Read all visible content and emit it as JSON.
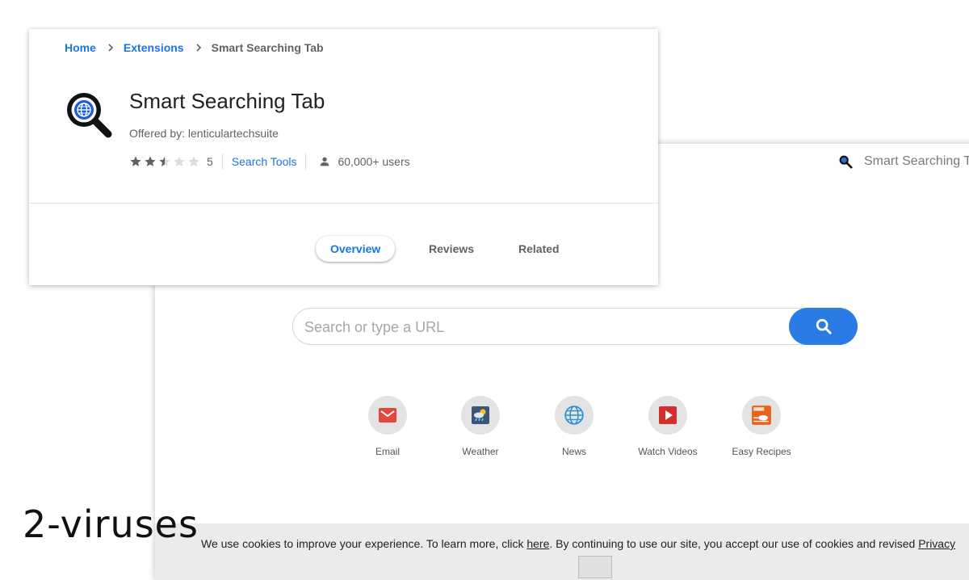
{
  "breadcrumb": {
    "home": "Home",
    "extensions": "Extensions",
    "current": "Smart Searching Tab"
  },
  "extension": {
    "title": "Smart Searching Tab",
    "offered_by": "Offered by: lenticulartechsuite",
    "rating": 2.5,
    "rating_count": "5",
    "category": "Search Tools",
    "users": "60,000+ users"
  },
  "tabs": {
    "overview": "Overview",
    "reviews": "Reviews",
    "related": "Related",
    "active": "Overview"
  },
  "newtab": {
    "brand": "Smart Searching Tab",
    "search_placeholder": "Search or type a URL",
    "shortcuts": {
      "email": "Email",
      "weather": "Weather",
      "news": "News",
      "videos": "Watch Videos",
      "recipes": "Easy Recipes"
    },
    "cookie": {
      "part1": "We use cookies to improve your experience. To learn more, click ",
      "link": "here",
      "part2": ". By continuing to use our site, you accept our use of cookies and revised ",
      "privacy": "Privacy"
    }
  },
  "watermark": "2-viruses",
  "colors": {
    "accent": "#1a73e8",
    "search_button": "#2a7be4",
    "star_filled": "#5f6368",
    "star_empty": "#dadce0"
  }
}
